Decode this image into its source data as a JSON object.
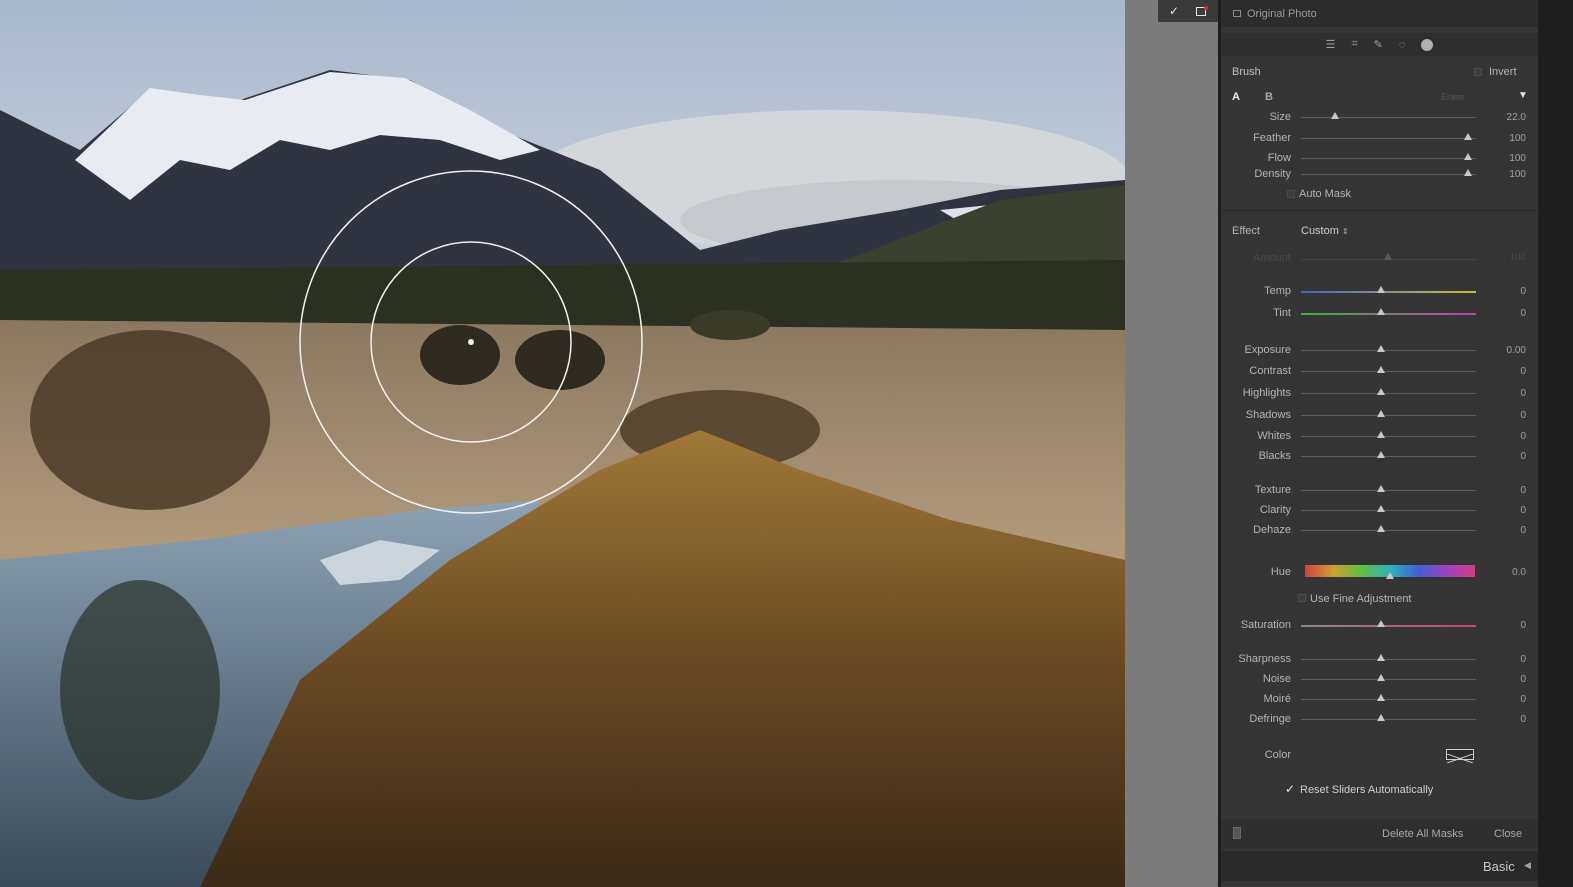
{
  "strip": {
    "confirm_glyph": "✓"
  },
  "header": {
    "title": "Original Photo"
  },
  "brush": {
    "title": "Brush",
    "invert_label": "Invert",
    "tab_a": "A",
    "tab_b": "B",
    "erase_label": "Erase",
    "sliders": [
      {
        "label": "Size",
        "value": "22.0",
        "fraction": 0.24
      },
      {
        "label": "Feather",
        "value": "100",
        "fraction": 1.0
      },
      {
        "label": "Flow",
        "value": "100",
        "fraction": 1.0
      },
      {
        "label": "Density",
        "value": "100",
        "fraction": 1.0
      }
    ],
    "auto_mask_label": "Auto Mask"
  },
  "effect": {
    "label": "Effect",
    "preset": "Custom",
    "amount_label": "Amount",
    "amount_value": "100",
    "groups": [
      [
        {
          "label": "Temp",
          "value": "0",
          "fraction": 0.5
        },
        {
          "label": "Tint",
          "value": "0",
          "fraction": 0.5
        }
      ],
      [
        {
          "label": "Exposure",
          "value": "0.00",
          "fraction": 0.5
        },
        {
          "label": "Contrast",
          "value": "0",
          "fraction": 0.5
        },
        {
          "label": "Highlights",
          "value": "0",
          "fraction": 0.5
        },
        {
          "label": "Shadows",
          "value": "0",
          "fraction": 0.5
        },
        {
          "label": "Whites",
          "value": "0",
          "fraction": 0.5
        },
        {
          "label": "Blacks",
          "value": "0",
          "fraction": 0.5
        }
      ],
      [
        {
          "label": "Texture",
          "value": "0",
          "fraction": 0.5
        },
        {
          "label": "Clarity",
          "value": "0",
          "fraction": 0.5
        },
        {
          "label": "Dehaze",
          "value": "0",
          "fraction": 0.5
        }
      ]
    ],
    "hue": {
      "label": "Hue",
      "value": "0.0",
      "fraction": 0.5
    },
    "fine_adjust_label": "Use Fine Adjustment",
    "saturation": {
      "label": "Saturation",
      "value": "0",
      "fraction": 0.5
    },
    "detail": [
      {
        "label": "Sharpness",
        "value": "0",
        "fraction": 0.5
      },
      {
        "label": "Noise",
        "value": "0",
        "fraction": 0.5
      },
      {
        "label": "Moiré",
        "value": "0",
        "fraction": 0.5
      },
      {
        "label": "Defringe",
        "value": "0",
        "fraction": 0.5
      }
    ],
    "color_label": "Color",
    "reset_label": "Reset Sliders Automatically",
    "reset_checked": true
  },
  "footer": {
    "delete_label": "Delete All Masks",
    "close_label": "Close"
  },
  "basic_panel": {
    "label": "Basic"
  },
  "colors": {
    "panel_bg": "#353535",
    "temp_start": "#4a62c8",
    "temp_end": "#c8c040",
    "tint_start": "#40b040",
    "tint_end": "#c040b0",
    "sat_start": "#8a8a8a",
    "sat_end": "#d04070"
  }
}
